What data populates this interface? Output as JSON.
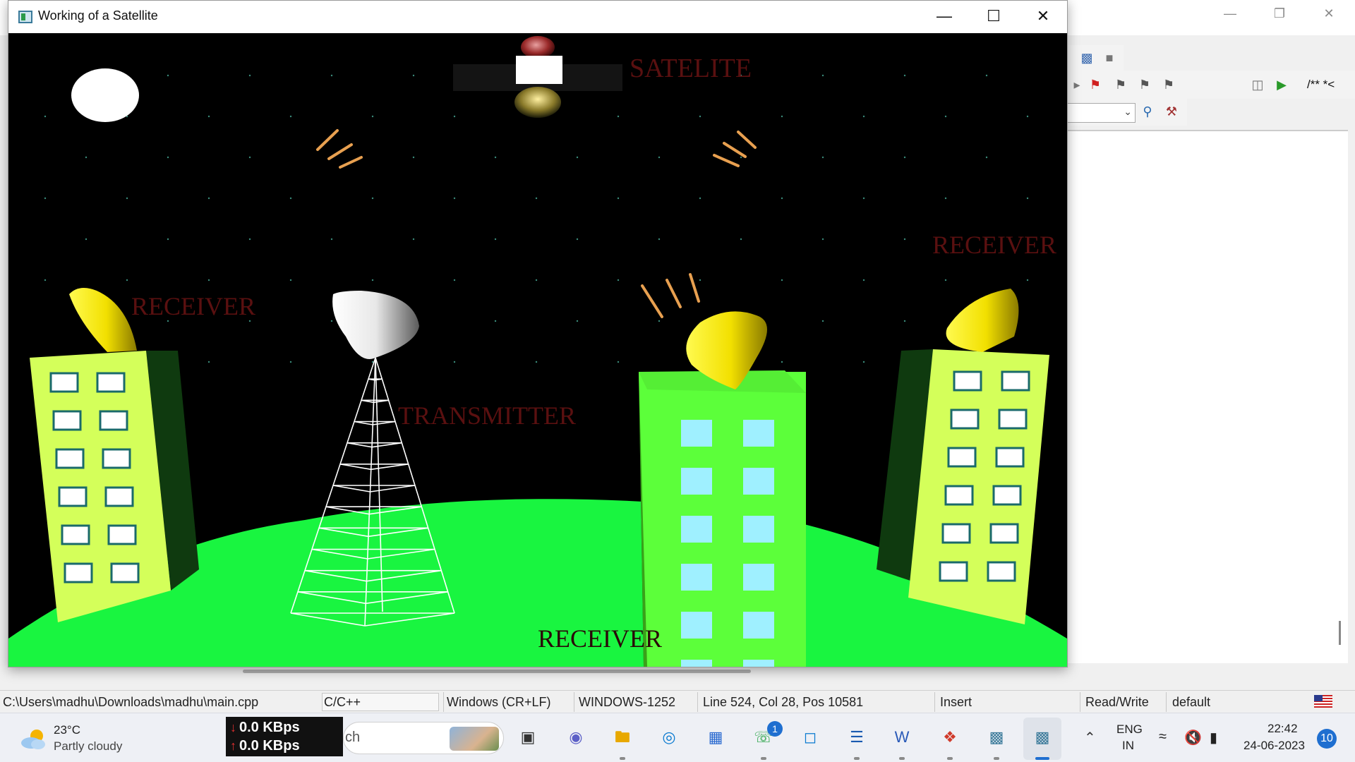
{
  "ide": {
    "toolbar_comment": "/** *<",
    "statusbar": {
      "file_path": "C:\\Users\\madhu\\Downloads\\madhu\\main.cpp",
      "language": "C/C++",
      "line_endings": "Windows (CR+LF)",
      "encoding": "WINDOWS-1252",
      "position": "Line 524, Col 28, Pos 10581",
      "mode": "Insert",
      "access": "Read/Write",
      "profile": "default"
    }
  },
  "window": {
    "title": "Working of a Satellite",
    "labels": {
      "satellite": "SATELITE",
      "receiver_left": "RECEIVER",
      "receiver_right": "RECEIVER",
      "receiver_bottom": "RECEIVER",
      "transmitter": "TRANSMITTER"
    },
    "colors": {
      "sky": "#000000",
      "ground": "#19f540",
      "label": "#5a1010",
      "dish_yellow": "#ffee00",
      "building_left": "#d4ff5a",
      "building_center": "#5cff3a",
      "window_blue": "#9ff0ff"
    }
  },
  "taskbar": {
    "weather_temp": "23°C",
    "weather_desc": "Partly cloudy",
    "net_down": "0.0 KBps",
    "net_up": "0.0 KBps",
    "search_text": "ch",
    "whatsapp_badge": "1",
    "lang_line1": "ENG",
    "lang_line2": "IN",
    "time": "22:42",
    "date": "24-06-2023",
    "notification_count": "10"
  }
}
